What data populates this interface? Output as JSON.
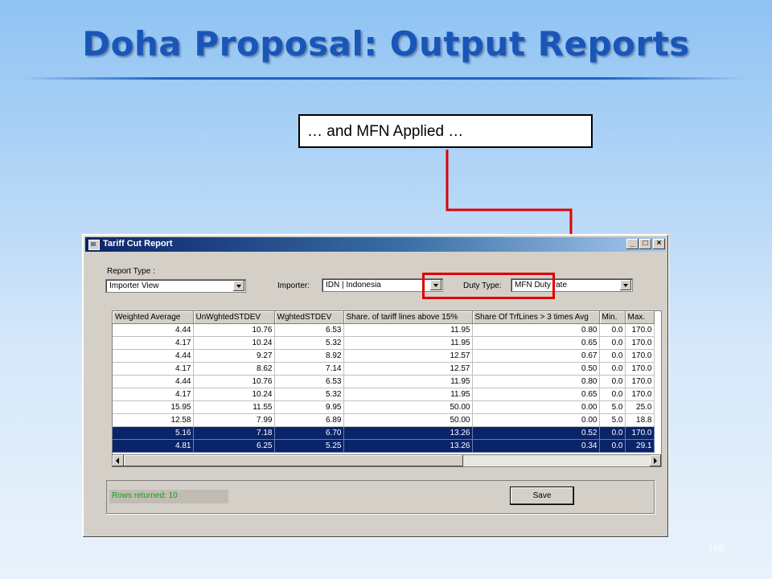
{
  "slide": {
    "title": "Doha Proposal: Output Reports",
    "callout": "… and MFN Applied …",
    "page_number": "166"
  },
  "window": {
    "title": "Tariff Cut Report",
    "min_label": "_",
    "max_label": "□",
    "close_label": "×"
  },
  "form": {
    "report_type_label": "Report Type :",
    "report_type_value": "Importer View",
    "importer_label": "Importer:",
    "importer_value": "IDN | Indonesia",
    "duty_type_label": "Duty Type:",
    "duty_type_value": "MFN Duty rate"
  },
  "grid": {
    "columns": [
      "Weighted Average",
      "UnWghtedSTDEV",
      "WghtedSTDEV",
      "Share. of tariff lines above 15%",
      "Share Of TrfLines > 3 times Avg",
      "Min.",
      "Max."
    ],
    "rows": [
      {
        "cells": [
          "4.44",
          "10.76",
          "6.53",
          "11.95",
          "0.80",
          "0.0",
          "170.0"
        ],
        "selected": false
      },
      {
        "cells": [
          "4.17",
          "10.24",
          "5.32",
          "11.95",
          "0.65",
          "0.0",
          "170.0"
        ],
        "selected": false
      },
      {
        "cells": [
          "4.44",
          "9.27",
          "8.92",
          "12.57",
          "0.67",
          "0.0",
          "170.0"
        ],
        "selected": false
      },
      {
        "cells": [
          "4.17",
          "8.62",
          "7.14",
          "12.57",
          "0.50",
          "0.0",
          "170.0"
        ],
        "selected": false
      },
      {
        "cells": [
          "4.44",
          "10.76",
          "6.53",
          "11.95",
          "0.80",
          "0.0",
          "170.0"
        ],
        "selected": false
      },
      {
        "cells": [
          "4.17",
          "10.24",
          "5.32",
          "11.95",
          "0.65",
          "0.0",
          "170.0"
        ],
        "selected": false
      },
      {
        "cells": [
          "15.95",
          "11.55",
          "9.95",
          "50.00",
          "0.00",
          "5.0",
          "25.0"
        ],
        "selected": false
      },
      {
        "cells": [
          "12.58",
          "7.99",
          "6.89",
          "50.00",
          "0.00",
          "5.0",
          "18.8"
        ],
        "selected": false
      },
      {
        "cells": [
          "5.16",
          "7.18",
          "6.70",
          "13.26",
          "0.52",
          "0.0",
          "170.0"
        ],
        "selected": true
      },
      {
        "cells": [
          "4.81",
          "6.25",
          "5.25",
          "13.26",
          "0.34",
          "0.0",
          "29.1"
        ],
        "selected": true
      }
    ]
  },
  "status": {
    "rows_returned": "Rows returned: 10",
    "save_label": "Save"
  },
  "colors": {
    "title": "#1a56b8",
    "highlight": "#e00000",
    "selection": "#0a246a",
    "rows_returned_text": "#1c9a1c"
  }
}
